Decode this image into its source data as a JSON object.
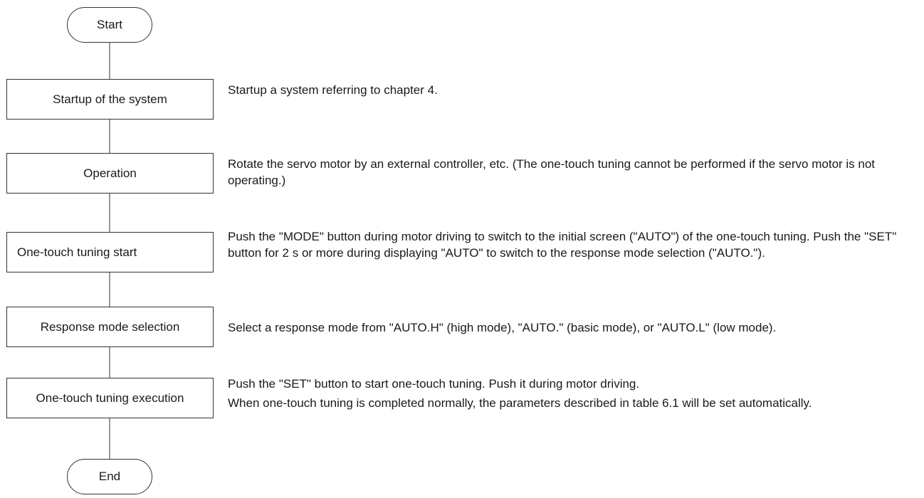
{
  "flowchart": {
    "start_label": "Start",
    "end_label": "End",
    "steps": [
      {
        "label": "Startup of the system",
        "description": [
          "Startup a system referring to chapter 4."
        ]
      },
      {
        "label": "Operation",
        "description": [
          "Rotate the servo motor by an external controller, etc. (The one-touch tuning cannot be performed if the servo motor is not operating.)"
        ]
      },
      {
        "label": "One-touch tuning start",
        "description": [
          "Push the \"MODE\" button during motor driving to switch to the initial screen (\"AUTO\") of the one-touch tuning. Push the \"SET\" button for 2 s or more during displaying \"AUTO\" to switch to the response mode selection (\"AUTO.\")."
        ]
      },
      {
        "label": "Response mode selection",
        "description": [
          "Select a response mode from \"AUTO.H\" (high mode), \"AUTO.\" (basic mode), or \"AUTO.L\" (low mode)."
        ]
      },
      {
        "label": "One-touch tuning execution",
        "description": [
          "Push the \"SET\" button to start one-touch tuning. Push it during motor driving.",
          "When one-touch tuning is completed normally, the parameters described in table 6.1 will be set automatically."
        ]
      }
    ]
  }
}
